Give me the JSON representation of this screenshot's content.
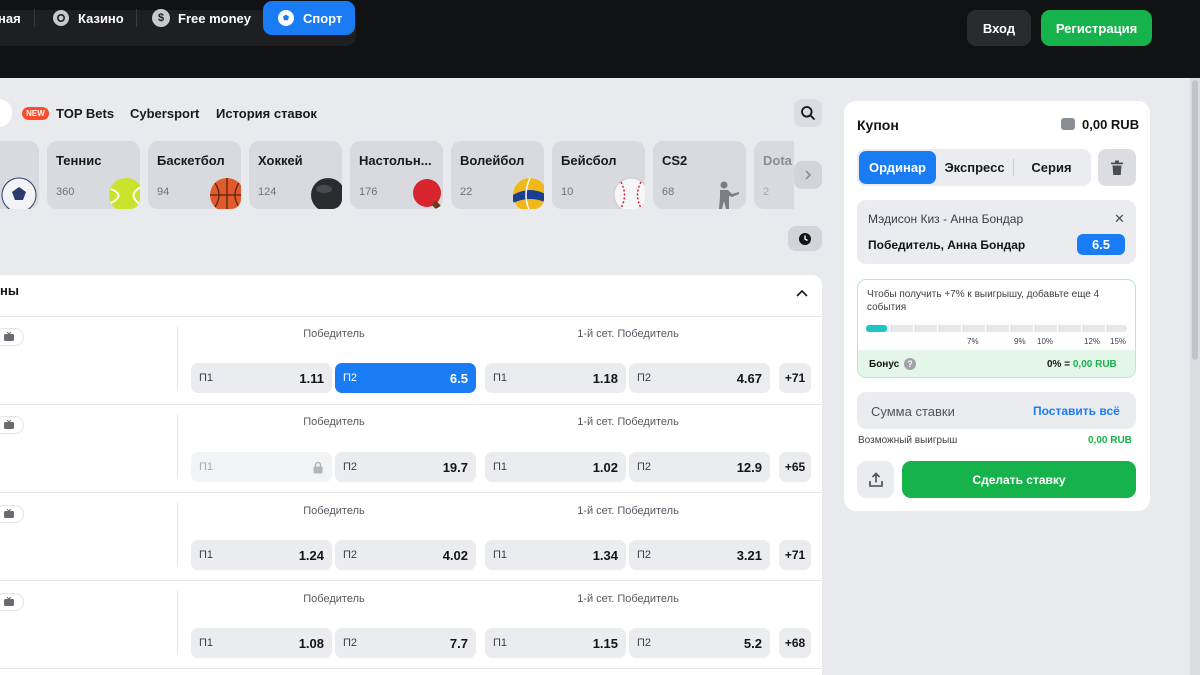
{
  "header": {
    "nav": [
      {
        "label": "ная"
      },
      {
        "label": "Казино",
        "icon": "casino-chip-icon"
      },
      {
        "label": "Free money",
        "icon": "dollar-coin-icon"
      },
      {
        "label": "Спорт",
        "icon": "soccer-ball-icon",
        "active": true
      }
    ],
    "login_label": "Вход",
    "register_label": "Регистрация"
  },
  "tabs": {
    "new_badge": "NEW",
    "top_bets": "TOP Bets",
    "cybersport": "Cybersport",
    "history": "История ставок"
  },
  "sports": [
    {
      "name": "Теннис",
      "count": "360",
      "icon": "tennis-ball-icon"
    },
    {
      "name": "Баскетбол",
      "count": "94",
      "icon": "basketball-icon"
    },
    {
      "name": "Хоккей",
      "count": "124",
      "icon": "hockey-puck-icon"
    },
    {
      "name": "Настольн...",
      "count": "176",
      "icon": "table-tennis-icon"
    },
    {
      "name": "Волейбол",
      "count": "22",
      "icon": "volleyball-icon"
    },
    {
      "name": "Бейсбол",
      "count": "10",
      "icon": "baseball-icon"
    },
    {
      "name": "CS2",
      "count": "68",
      "icon": "soldier-icon"
    },
    {
      "name": "Dota",
      "count": "2",
      "icon": ""
    }
  ],
  "panel": {
    "title": "ны"
  },
  "matches": [
    {
      "market1": "Победитель",
      "market2": "1-й сет. Победитель",
      "odds": [
        {
          "k": "П1",
          "v": "1.11"
        },
        {
          "k": "П2",
          "v": "6.5",
          "selected": true
        },
        {
          "k": "П1",
          "v": "1.18"
        },
        {
          "k": "П2",
          "v": "4.67"
        }
      ],
      "more": "+71"
    },
    {
      "market1": "Победитель",
      "market2": "1-й сет. Победитель",
      "odds": [
        {
          "k": "П1",
          "v": "",
          "locked": true
        },
        {
          "k": "П2",
          "v": "19.7"
        },
        {
          "k": "П1",
          "v": "1.02"
        },
        {
          "k": "П2",
          "v": "12.9"
        }
      ],
      "more": "+65"
    },
    {
      "market1": "Победитель",
      "market2": "1-й сет. Победитель",
      "odds": [
        {
          "k": "П1",
          "v": "1.24"
        },
        {
          "k": "П2",
          "v": "4.02"
        },
        {
          "k": "П1",
          "v": "1.34"
        },
        {
          "k": "П2",
          "v": "3.21"
        }
      ],
      "more": "+71"
    },
    {
      "market1": "Победитель",
      "market2": "1-й сет. Победитель",
      "odds": [
        {
          "k": "П1",
          "v": "1.08"
        },
        {
          "k": "П2",
          "v": "7.7"
        },
        {
          "k": "П1",
          "v": "1.15"
        },
        {
          "k": "П2",
          "v": "5.2"
        }
      ],
      "more": "+68"
    }
  ],
  "coupon": {
    "title": "Купон",
    "balance": "0,00 RUB",
    "modes": [
      "Ординар",
      "Экспресс",
      "Серия"
    ],
    "bet": {
      "match": "Мэдисон Киз - Анна Бондар",
      "outcome": "Победитель, Анна Бондар",
      "odd": "6.5"
    },
    "bonus": {
      "text": "Чтобы получить +7% к выигрышу, добавьте еще 4 события",
      "progress": 0.08,
      "ticks": [
        "7%",
        "9%",
        "10%",
        "12%",
        "15%"
      ],
      "label": "Бонус",
      "value_pct": "0% = ",
      "value_amount": "0,00 RUB"
    },
    "stake_placeholder": "Сумма ставки",
    "stake_all": "Поставить всё",
    "possible_win_label": "Возможный выигрыш",
    "possible_win_value": "0,00 RUB",
    "place_bet": "Сделать ставку"
  },
  "colors": {
    "accent": "#1a7cf5",
    "green": "#16b24b",
    "header_bg": "#111214"
  }
}
